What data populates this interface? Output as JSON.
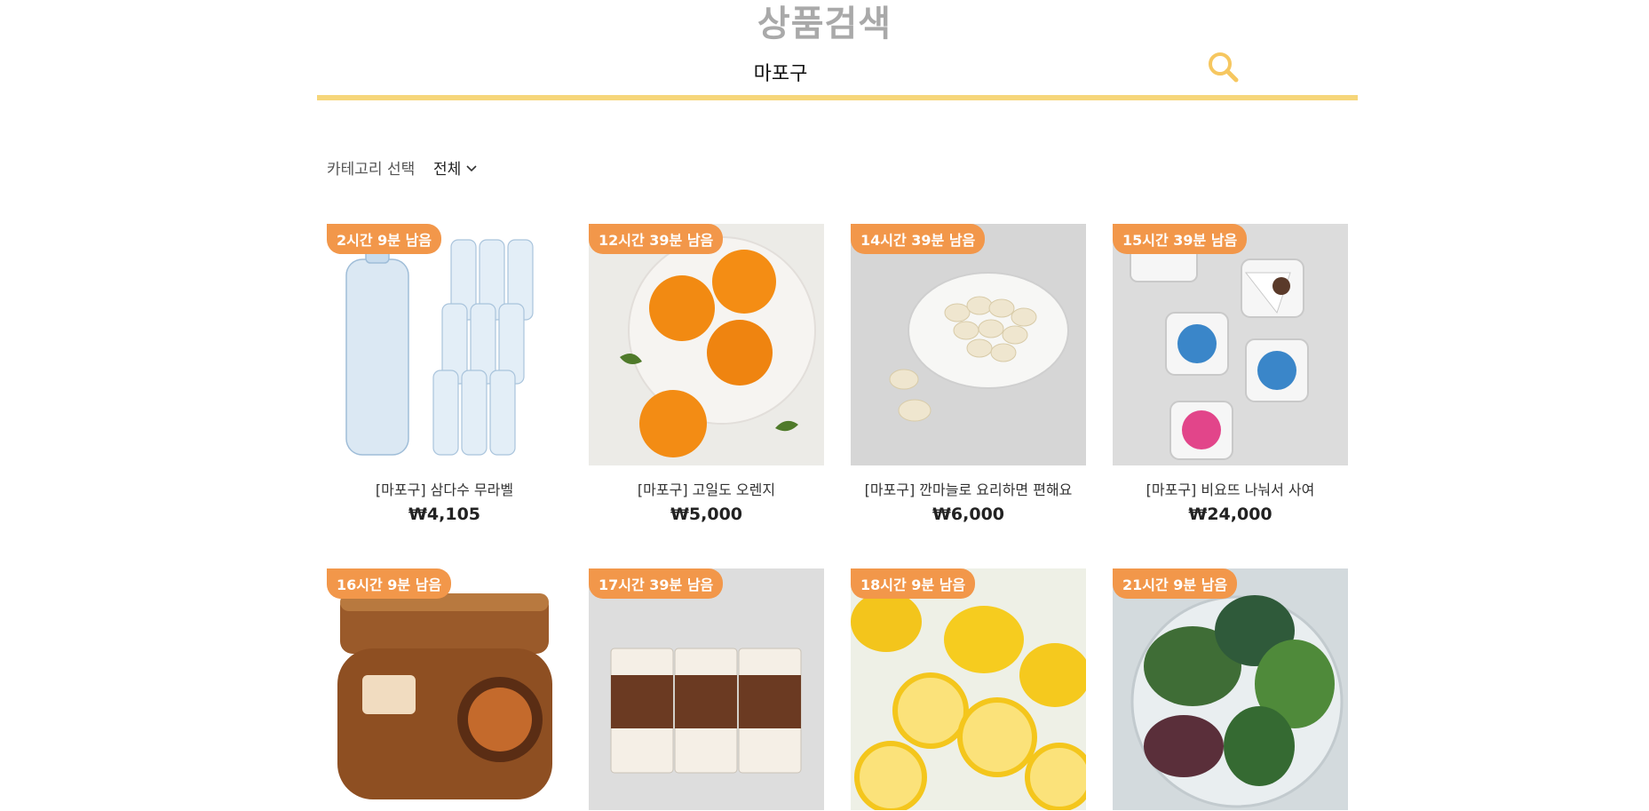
{
  "header": {
    "title": "상품검색"
  },
  "search": {
    "value": "마포구",
    "icon": "search-icon"
  },
  "filter": {
    "label": "카테고리 선택",
    "selected": "전체"
  },
  "colors": {
    "accent_yellow": "#f6d67a",
    "badge_orange": "#f2974a",
    "title_gray": "#a9a9a9"
  },
  "products": [
    {
      "time_left": "2시간 9분 남음",
      "name": "[마포구] 삼다수 무라벨",
      "price": "₩4,105",
      "image": "water-bottles-image"
    },
    {
      "time_left": "12시간 39분 남음",
      "name": "[마포구] 고일도 오렌지",
      "price": "₩5,000",
      "image": "oranges-image"
    },
    {
      "time_left": "14시간 39분 남음",
      "name": "[마포구] 깐마늘로 요리하면 편해요",
      "price": "₩6,000",
      "image": "garlic-image"
    },
    {
      "time_left": "15시간 39분 남음",
      "name": "[마포구] 비요뜨 나눠서 사여",
      "price": "₩24,000",
      "image": "yogurt-image"
    },
    {
      "time_left": "16시간 9분 남음",
      "name": "",
      "price": "",
      "image": "doenjang-jjigae-image"
    },
    {
      "time_left": "17시간 39분 남음",
      "name": "",
      "price": "",
      "image": "chocolate-milk-image"
    },
    {
      "time_left": "18시간 9분 남음",
      "name": "",
      "price": "",
      "image": "lemons-image"
    },
    {
      "time_left": "21시간 9분 남음",
      "name": "",
      "price": "",
      "image": "leafy-greens-image"
    }
  ]
}
